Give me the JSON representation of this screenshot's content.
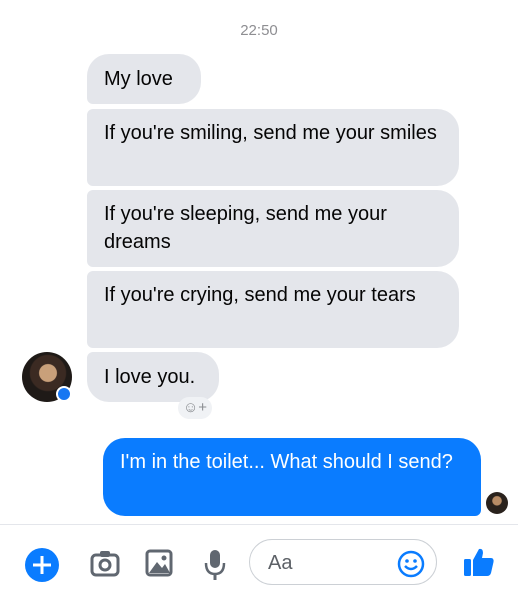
{
  "conversation": {
    "timestamp": "22:50",
    "incoming_messages": [
      "My love",
      "If you're smiling, send me your smiles",
      "If you're sleeping, send me your dreams",
      "If you're crying, send me your tears",
      "I love you."
    ],
    "outgoing_messages": [
      "I'm in the toilet... What should I send?"
    ],
    "reaction_button": "☺+"
  },
  "composer": {
    "placeholder": "Aa",
    "icons": [
      "plus-icon",
      "camera-icon",
      "gallery-icon",
      "microphone-icon",
      "emoji-icon",
      "thumbs-up-icon"
    ],
    "accent_color": "#0a7cff"
  }
}
